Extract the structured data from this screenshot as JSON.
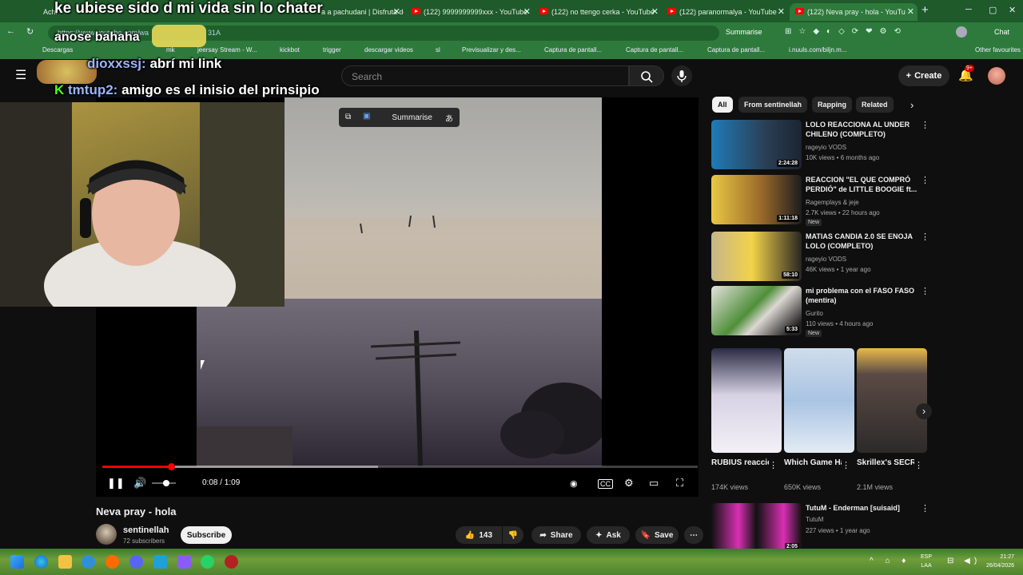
{
  "browser": {
    "tabs": [
      {
        "label": "Achie...",
        "active": false
      },
      {
        "label": "a a pachudani | Disfruta de",
        "active": false
      },
      {
        "label": "(122) 9999999999xxx - YouTube",
        "active": false
      },
      {
        "label": "(122) no ttengo cerka - YouTube",
        "active": false
      },
      {
        "label": "(122) paranormalya - YouTube",
        "active": false
      },
      {
        "label": "(122) Neva pray - hola - YouTu",
        "active": true
      }
    ],
    "url": "https://www.youtube.com/wa",
    "url_suffix": "31A",
    "summarise_label": "Summarise",
    "chat_label": "Chat",
    "bookmarks": [
      "Descargas",
      "mk",
      "jeersay Stream - W...",
      "kickbot",
      "trigger",
      "descargar videos",
      "sl",
      "Previsualizar y des...",
      "Captura de pantall...",
      "Captura de pantall...",
      "Captura de pantall...",
      "i.nuuls.com/biljn.m...",
      "Other favourites"
    ]
  },
  "youtube": {
    "search_placeholder": "Search",
    "create_label": "Create",
    "notif_count": "9+",
    "player": {
      "summarise_label": "Summarise",
      "timecode": "0:08 / 1:09",
      "progress": 0.116
    },
    "video_title": "Neva pray - hola",
    "channel_name": "sentinellah",
    "subscribers": "72 subscribers",
    "subscribe_label": "Subscribe",
    "likes": "143",
    "share_label": "Share",
    "ask_label": "Ask",
    "save_label": "Save",
    "chips": [
      "All",
      "From sentinellah",
      "Rapping",
      "Related"
    ],
    "recommendations": [
      {
        "title": "LOLO REACCIONA AL UNDER CHILENO (COMPLETO)",
        "channel": "rageyio VODS",
        "meta": "10K views • 6 months ago",
        "duration": "2:24:28",
        "badge": "",
        "thumb_color": "#2b6fa8"
      },
      {
        "title": "REACCION \"EL QUE COMPRÓ PERDIÓ\" de LITTLE BOOGIE ft...",
        "channel": "Ragemplays & jeje",
        "meta": "2.7K views • 22 hours ago",
        "duration": "1:11:18",
        "badge": "New",
        "thumb_color": "#c9a33a"
      },
      {
        "title": "MATIAS CANDIA 2.0 SE ENOJA LOLO (COMPLETO)",
        "channel": "rageyio VODS",
        "meta": "46K views • 1 year ago",
        "duration": "58:10",
        "badge": "",
        "thumb_color": "#b8a678"
      },
      {
        "title": "mi problema con el FASO FASO (mentira)",
        "channel": "Gurito",
        "meta": "110 views • 4 hours ago",
        "duration": "5:33",
        "badge": "New",
        "thumb_color": "#d8d3d0"
      }
    ],
    "shorts": [
      {
        "title": "RUBIUS reacciona a...",
        "views": "174K views",
        "color": "#d6d2e2"
      },
      {
        "title": "Which Game Has Better ...",
        "views": "650K views",
        "color": "#a8c2de"
      },
      {
        "title": "Skrillex's SECRET To ...",
        "views": "2.1M views",
        "color": "#4a4442"
      }
    ],
    "last_rec": {
      "title": "TutuM - Enderman [suisaid]",
      "channel": "TutuM",
      "meta": "227 views • 1 year ago",
      "duration": "2:05"
    }
  },
  "overlay": {
    "headline": "ke ubiese sido d mi vida sin lo chater",
    "subline": "anose bahaha",
    "chat": [
      {
        "user": "dioxxssj:",
        "message": "abrí mi link"
      },
      {
        "user": "tmtup2:",
        "message": "amigo es el inisio del prinsipio"
      }
    ]
  },
  "taskbar": {
    "lang_top": "ESP",
    "lang_bottom": "LAA",
    "time": "21:27",
    "date": "26/04/2026"
  },
  "colors": {
    "accent": "#ff0000",
    "browser_green": "#2e7a3c"
  }
}
